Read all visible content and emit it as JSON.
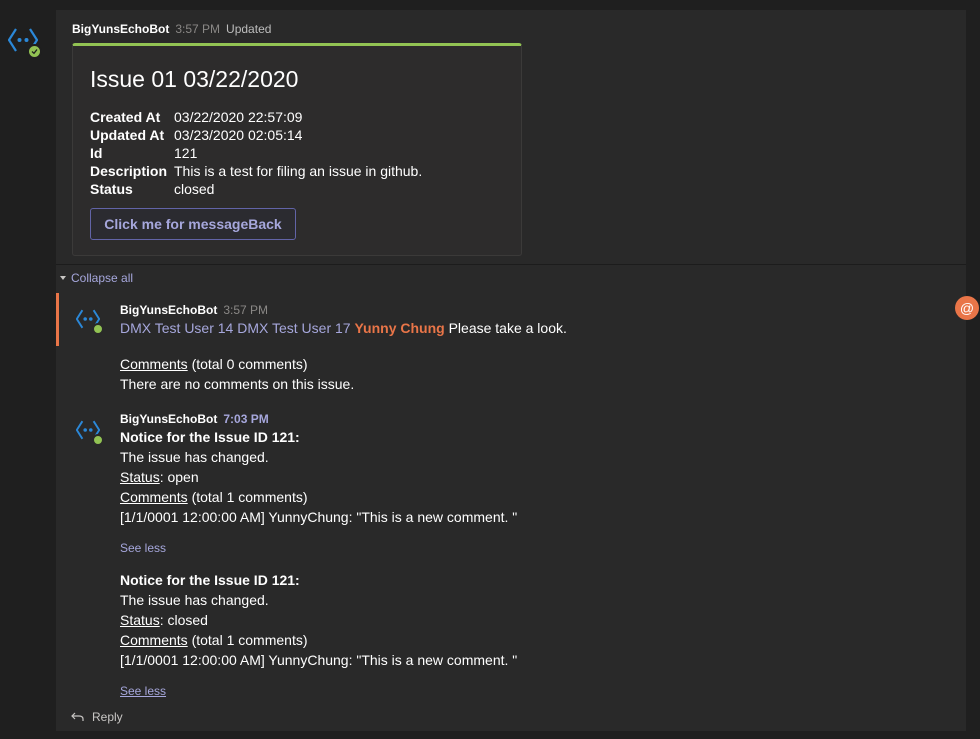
{
  "message": {
    "author": "BigYunsEchoBot",
    "time": "3:57 PM",
    "status": "Updated"
  },
  "card": {
    "title": "Issue 01 03/22/2020",
    "facts": [
      {
        "key": "Created At",
        "value": "03/22/2020 22:57:09"
      },
      {
        "key": "Updated At",
        "value": "03/23/2020 02:05:14"
      },
      {
        "key": "Id",
        "value": "121"
      },
      {
        "key": "Description",
        "value": "This is a test for filing an issue in github."
      },
      {
        "key": "Status",
        "value": "closed"
      }
    ],
    "button_label": "Click me for messageBack"
  },
  "thread": {
    "collapse_label": "Collapse all",
    "reply_label": "Reply"
  },
  "reply1": {
    "author": "BigYunsEchoBot",
    "time": "3:57 PM",
    "mention_1": "DMX Test User 14",
    "mention_2": "DMX Test User 17",
    "mention_self": "Yunny Chung",
    "text": "Please take a look.",
    "comments_link": "Comments",
    "comments_total": "(total 0 comments)",
    "no_comments": "There are no comments on this issue."
  },
  "reply2": {
    "author": "BigYunsEchoBot",
    "time": "7:03 PM",
    "notices": [
      {
        "heading": "Notice for the Issue ID 121:",
        "changed": "The issue has changed.",
        "status_label": "Status",
        "status_value": ": open",
        "comments_link": "Comments",
        "comments_total": "(total 1 comments)",
        "comment": "[1/1/0001 12:00:00 AM] YunnyChung: \"This is a new comment. \"",
        "see_less": "See less"
      },
      {
        "heading": "Notice for the Issue ID 121:",
        "changed": "The issue has changed.",
        "status_label": "Status",
        "status_value": ": closed",
        "comments_link": "Comments",
        "comments_total": "(total 1 comments)",
        "comment": "[1/1/0001 12:00:00 AM] YunnyChung: \"This is a new comment. \"",
        "see_less": "See less"
      }
    ]
  },
  "icons": {
    "bot_avatar": "bot-avatar-icon",
    "presence": "presence-available-icon",
    "mention": "at-mention-icon",
    "reply": "reply-arrow-icon",
    "collapse": "caret-down-icon"
  },
  "colors": {
    "accent": "#6264a7",
    "mention_orange": "#e97548",
    "presence_green": "#92c353",
    "card_top": "#92c353"
  }
}
